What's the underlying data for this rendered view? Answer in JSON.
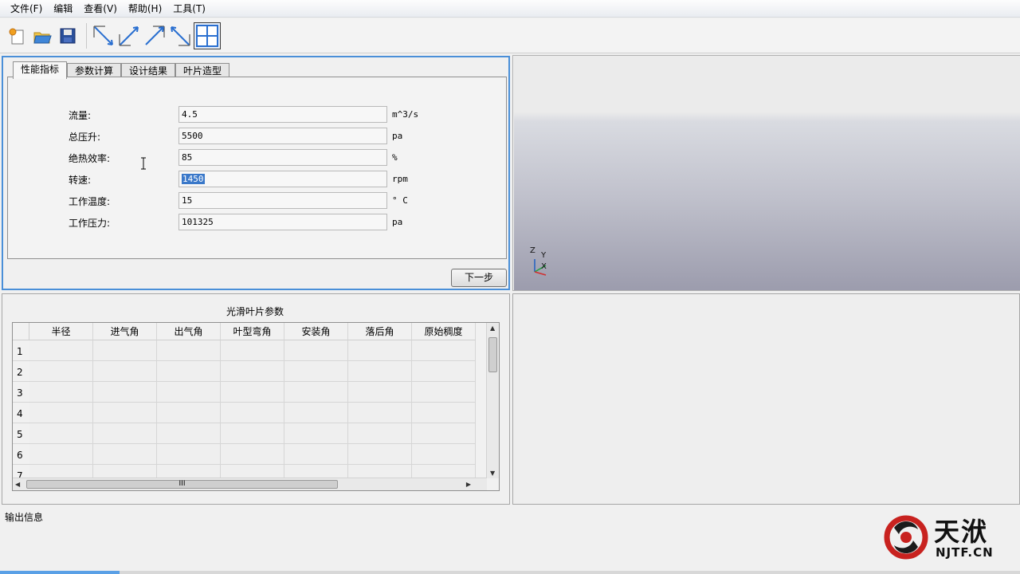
{
  "menu": [
    "文件(F)",
    "编辑",
    "查看(V)",
    "帮助(H)",
    "工具(T)"
  ],
  "toolbar": {
    "buttons": [
      "new-icon",
      "open-folder-icon",
      "save-icon",
      "view-top-left-icon",
      "view-bottom-left-icon",
      "view-top-right-icon",
      "view-bottom-right-icon",
      "four-view-icon"
    ]
  },
  "tabs": [
    "性能指标",
    "参数计算",
    "设计结果",
    "叶片造型"
  ],
  "fields": [
    {
      "label": "流量:",
      "value": "4.5",
      "unit": "m^3/s"
    },
    {
      "label": "总压升:",
      "value": "5500",
      "unit": "pa"
    },
    {
      "label": "绝热效率:",
      "value": "85",
      "unit": "%"
    },
    {
      "label": "转速:",
      "value": "1450",
      "unit": "rpm"
    },
    {
      "label": "工作温度:",
      "value": "15",
      "unit": "° C"
    },
    {
      "label": "工作压力:",
      "value": "101325",
      "unit": "pa"
    }
  ],
  "next_button": "下一步",
  "axis": {
    "z": "Z",
    "y": "Y",
    "x": "X"
  },
  "table": {
    "title": "光滑叶片参数",
    "columns": [
      "半径",
      "进气角",
      "出气角",
      "叶型弯角",
      "安装角",
      "落后角",
      "原始稠度"
    ],
    "rows": [
      "1",
      "2",
      "3",
      "4",
      "5",
      "6",
      "7"
    ],
    "hscroll_grip": "III"
  },
  "output_label": "输出信息",
  "logo": {
    "name": "天洑",
    "domain": "NJTF.CN"
  },
  "colors": {
    "focus_border": "#4a8fd8",
    "selection": "#3a78c9"
  }
}
